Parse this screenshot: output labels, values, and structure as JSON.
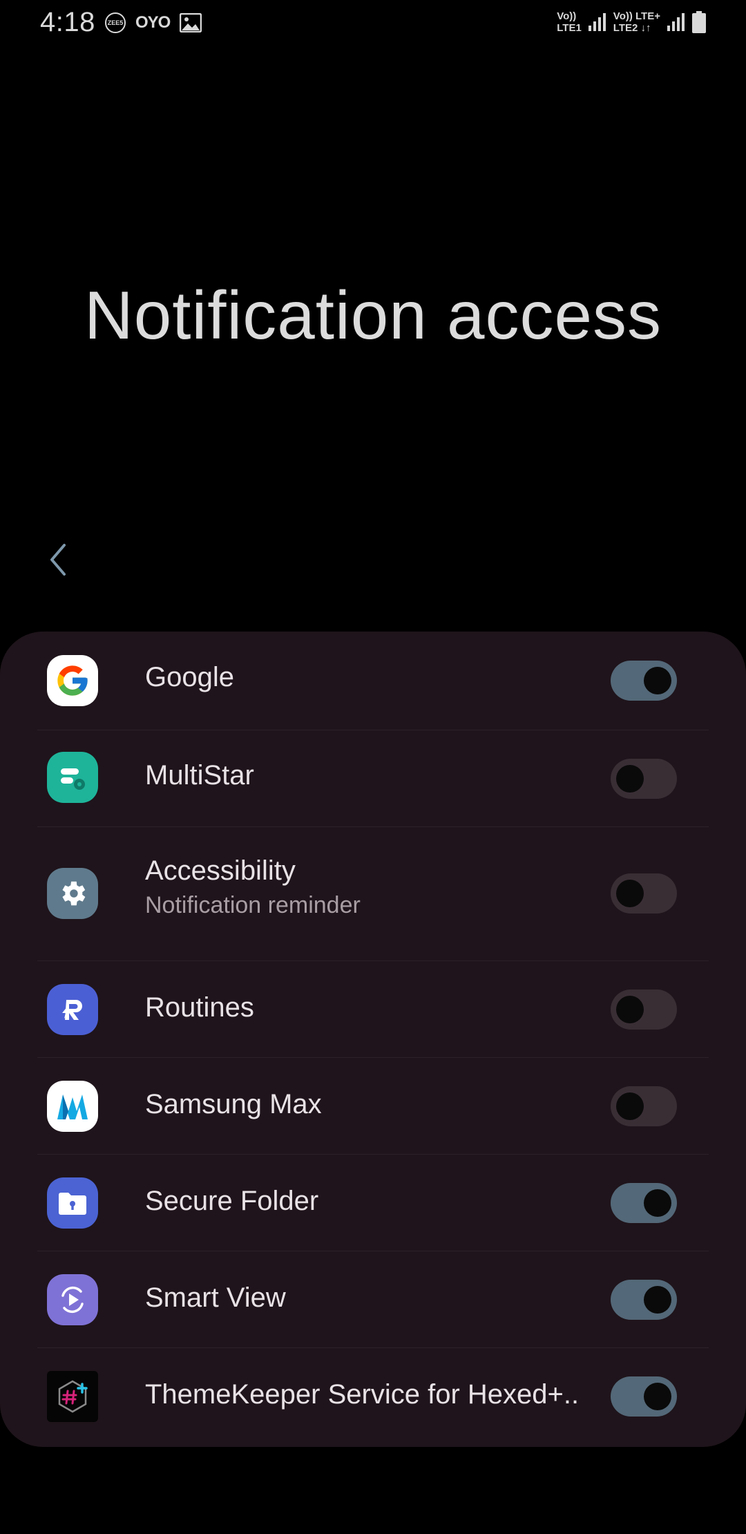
{
  "status_bar": {
    "time": "4:18",
    "left_icons": [
      "zee5-icon",
      "oyo-icon",
      "gallery-icon"
    ],
    "zee_text": "ZEE5",
    "oyo_text": "OYO",
    "sim1_top": "Vo))",
    "sim1_bottom": "LTE1",
    "sim2_top": "Vo)) LTE+",
    "sim2_bottom": "LTE2 ↓↑"
  },
  "page": {
    "title": "Notification access"
  },
  "apps": [
    {
      "name": "Google",
      "subtitle": "",
      "icon": "google-icon",
      "enabled": true
    },
    {
      "name": "MultiStar",
      "subtitle": "",
      "icon": "multistar-icon",
      "enabled": false
    },
    {
      "name": "Accessibility",
      "subtitle": "Notification reminder",
      "icon": "settings-gear-icon",
      "enabled": false
    },
    {
      "name": "Routines",
      "subtitle": "",
      "icon": "routines-icon",
      "enabled": false
    },
    {
      "name": "Samsung Max",
      "subtitle": "",
      "icon": "samsung-max-icon",
      "enabled": false
    },
    {
      "name": "Secure Folder",
      "subtitle": "",
      "icon": "secure-folder-icon",
      "enabled": true
    },
    {
      "name": "Smart View",
      "subtitle": "",
      "icon": "smart-view-icon",
      "enabled": true
    },
    {
      "name": "ThemeKeeper Service for Hexed+..",
      "subtitle": "",
      "icon": "themekeeper-icon",
      "enabled": true
    }
  ],
  "colors": {
    "background": "#000000",
    "card": "#1f141b",
    "toggle_on": "#536878",
    "toggle_off": "#3a2e35"
  }
}
